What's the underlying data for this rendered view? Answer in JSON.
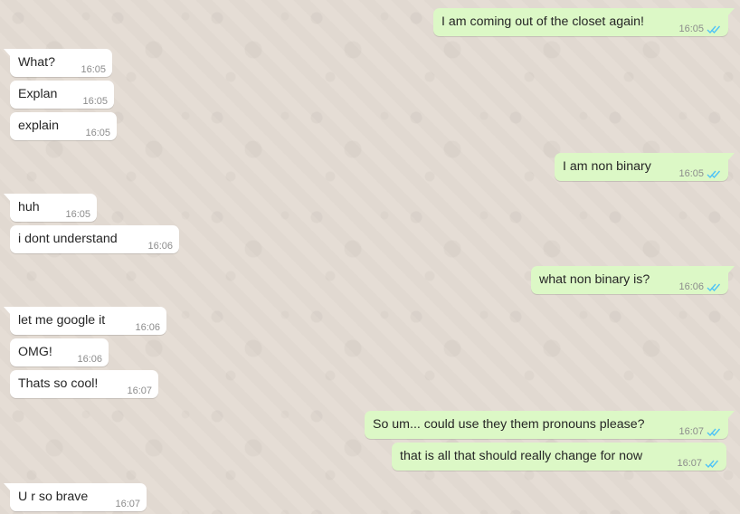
{
  "messages": [
    {
      "dir": "out",
      "text": "I am coming out of the closet again!",
      "time": "16:05",
      "read": true
    },
    {
      "dir": "in",
      "text": "What?",
      "time": "16:05"
    },
    {
      "dir": "in",
      "text": "Explan",
      "time": "16:05"
    },
    {
      "dir": "in",
      "text": "explain",
      "time": "16:05"
    },
    {
      "dir": "out",
      "text": "I am non binary",
      "time": "16:05",
      "read": true
    },
    {
      "dir": "in",
      "text": "huh",
      "time": "16:05"
    },
    {
      "dir": "in",
      "text": "i dont understand",
      "time": "16:06"
    },
    {
      "dir": "out",
      "text": "what non binary is?",
      "time": "16:06",
      "read": true
    },
    {
      "dir": "in",
      "text": "let me google it",
      "time": "16:06"
    },
    {
      "dir": "in",
      "text": "OMG!",
      "time": "16:06"
    },
    {
      "dir": "in",
      "text": "Thats so cool!",
      "time": "16:07"
    },
    {
      "dir": "out",
      "text": "So um... could use they them pronouns please?",
      "time": "16:07",
      "read": true
    },
    {
      "dir": "out",
      "text": "that is all that should really change for now",
      "time": "16:07",
      "read": true
    },
    {
      "dir": "in",
      "text": "U r so brave",
      "time": "16:07"
    }
  ],
  "colors": {
    "incoming_bg": "#ffffff",
    "outgoing_bg": "#dcf8c6",
    "read_tick": "#4fc3f7",
    "wallpaper": "#e5ddd5"
  }
}
